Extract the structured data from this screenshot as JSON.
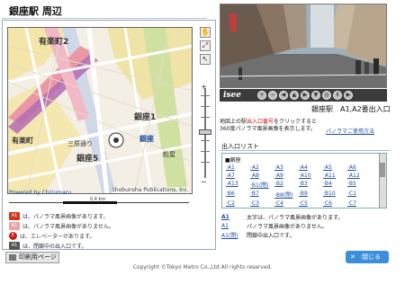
{
  "title": "銀座駅 周辺",
  "map": {
    "powered": "Powered by Chizumaru",
    "copyright": "Shobunsha Publications, Inc.",
    "scale_label": "0.4 km",
    "labels": [
      "有楽町2",
      "銀座1",
      "有楽町",
      "三原通り",
      "銀座5",
      "銀座",
      "松屋"
    ]
  },
  "tools": [
    "hand-tool-icon",
    "zoom-area-icon",
    "select-arrow-icon"
  ],
  "legend": [
    {
      "code": "A1",
      "color": "#d0361f",
      "text": "は、パノラマ風景画像があります。"
    },
    {
      "code": "A1",
      "color": "#e8a3a3",
      "text": "は、パノラマ風景画像がありません。"
    },
    {
      "code": "E",
      "color": "#cc1a1a",
      "text": "は、エレベーターがあります。"
    },
    {
      "code": "A1",
      "color": "#555555",
      "text": "は、閉鎖中の出入口です。"
    }
  ],
  "isee": {
    "logo": "isee",
    "buttons": [
      "+",
      "−",
      "◀",
      "▲",
      "▶",
      "▼",
      "◎",
      "Ⅱ",
      "▶"
    ]
  },
  "station_label": "銀座駅　A1,A2番出入口",
  "desc": {
    "line1a": "地図上の駅",
    "line1b": "出入口番号",
    "line1c": "をクリックすると",
    "line2": "360度パノラマ風景画像を表示します。"
  },
  "usage_link": "パノラマご使用方法",
  "list_head": "出入口リスト",
  "list_group": "■銀座",
  "exits": [
    "A1",
    "A2",
    "A3",
    "A4",
    "A5",
    "A6",
    "A7",
    "A8",
    "A9",
    "A10",
    "A11",
    "A12",
    "A13",
    "B1(閉)",
    "B2",
    "B3",
    "B4",
    "B5",
    "B6",
    "B7",
    "B8(閉)",
    "B9",
    "B10",
    "C1",
    "C2",
    "C3",
    "C4",
    "C5",
    "C6",
    "C7"
  ],
  "notes": [
    {
      "key": "A1",
      "text": "太字は、パノラマ風景画像があります。"
    },
    {
      "key": "A1",
      "text": "パノラマ風景画像がありません。"
    },
    {
      "key": "A1(閉)",
      "text": "閉鎖中出入口です。"
    }
  ],
  "print_button": "印刷用ページ",
  "close_button": "閉じる",
  "footer": "Copyright ©Tokyo Metro Co.,Ltd All rights reserved."
}
